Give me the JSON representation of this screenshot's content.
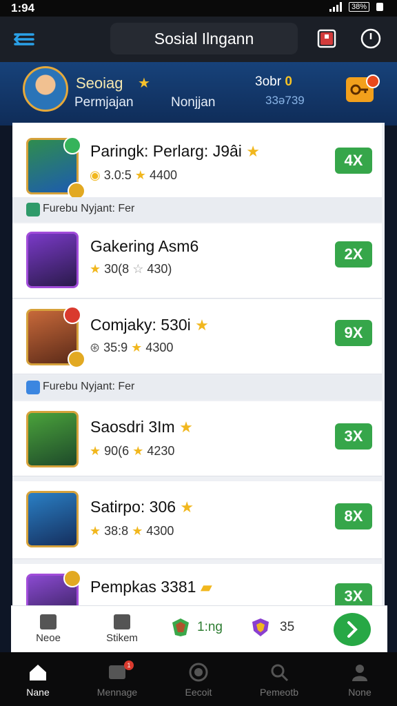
{
  "status": {
    "time": "1:94",
    "battery": "38%"
  },
  "appbar": {
    "title": "Sosial Ilngann"
  },
  "profile": {
    "name": "Seoiag",
    "left_label": "Permjajan",
    "mid_label": "Nonjjan",
    "coins_prefix": "3obr",
    "coins_value": "0",
    "sub_value": "33ə739"
  },
  "colors": {
    "accent": "#36a64a",
    "header": "#17427a",
    "gold": "#f1b71e"
  },
  "list": {
    "items": [
      {
        "title": "Paringk: Perlarg: J9âi",
        "meta1": "3.0:5",
        "meta2": "4400",
        "multiplier": "4X"
      },
      {
        "title": "Gakering Asm6",
        "meta1": "30(8",
        "meta2": "430)",
        "multiplier": "2X"
      },
      {
        "title": "Comjaky: 530i",
        "meta1": "35:9",
        "meta2": "4300",
        "multiplier": "9X"
      },
      {
        "title": "Saosdri 3Im",
        "meta1": "90(6",
        "meta2": "4230",
        "multiplier": "3X"
      },
      {
        "title": "Satirpo: 306",
        "meta1": "38:8",
        "meta2": "4300",
        "multiplier": "8X"
      },
      {
        "title": "Pempkas 3381",
        "meta1": "",
        "meta2": "",
        "multiplier": "3X"
      }
    ],
    "sections": [
      "Furebu Nyjant: Fer",
      "Furebu Nyjant: Fer"
    ]
  },
  "mini": {
    "home": "Neoe",
    "stickers": "Stikem",
    "gem_value": "1:ng",
    "shield_value": "35"
  },
  "nav": {
    "home": "Nane",
    "message": "Mennage",
    "account": "Eecoit",
    "search": "Pemeotb",
    "profile": "None",
    "message_badge": "1"
  }
}
